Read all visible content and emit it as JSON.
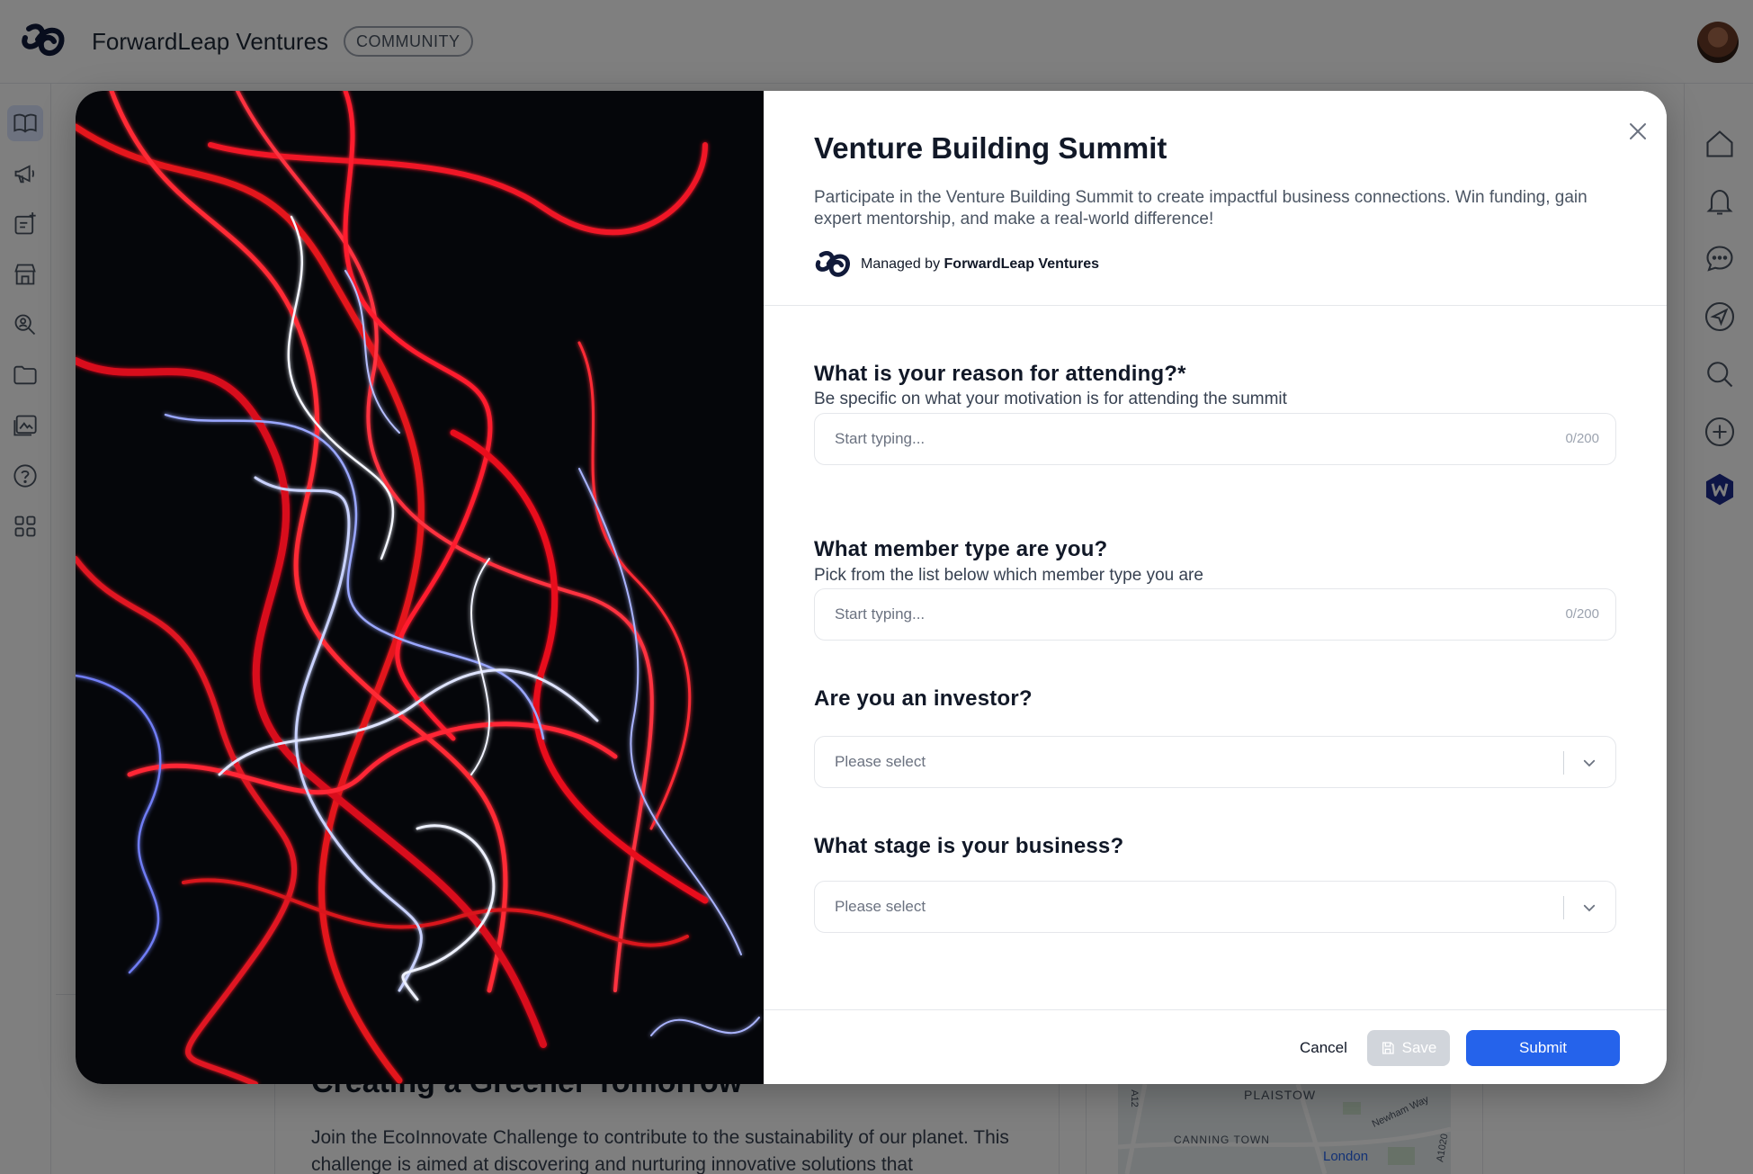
{
  "app": {
    "org_name": "ForwardLeap Ventures",
    "badge": "COMMUNITY",
    "left_nav_icons": [
      "book-icon",
      "megaphone-icon",
      "new-post-icon",
      "store-icon",
      "search-person-icon",
      "folder-icon",
      "gallery-icon",
      "help-icon",
      "apps-grid-icon"
    ],
    "right_nav_icons": [
      "home-icon",
      "bell-icon",
      "chat-icon",
      "send-icon",
      "search-icon",
      "add-icon",
      "workspace-app-icon"
    ]
  },
  "background": {
    "card_title": "Creating a Greener Tomorrow",
    "card_text": "Join the EcoInnovate Challenge to contribute to the sustainability of our planet. This challenge is aimed at discovering and nurturing innovative solutions that",
    "map_labels": [
      "PLAISTOW",
      "CANNING TOWN",
      "London",
      "Newham Way",
      "A12",
      "A1020"
    ]
  },
  "modal": {
    "title": "Venture Building Summit",
    "description": "Participate in the Venture Building Summit to create impactful business connections. Win funding, gain expert mentorship, and make a real-world difference!",
    "managed_prefix": "Managed by",
    "managed_org": "ForwardLeap Ventures",
    "questions": [
      {
        "title": "What is your reason for attending?*",
        "subtitle": "Be specific on what your motivation is for attending the summit",
        "placeholder": "Start typing...",
        "counter": "0/200"
      },
      {
        "title": "What member type are you?",
        "subtitle": "Pick from the list below which member type you are",
        "placeholder": "Start typing...",
        "counter": "0/200"
      },
      {
        "title": "Are you an investor?",
        "placeholder": "Please select"
      },
      {
        "title": "What stage is your business?",
        "placeholder": "Please select"
      }
    ],
    "buttons": {
      "cancel": "Cancel",
      "save": "Save",
      "submit": "Submit"
    }
  },
  "colors": {
    "accent": "#2563eb",
    "brand_dark": "#111a3a",
    "disabled": "#d1d5db"
  }
}
